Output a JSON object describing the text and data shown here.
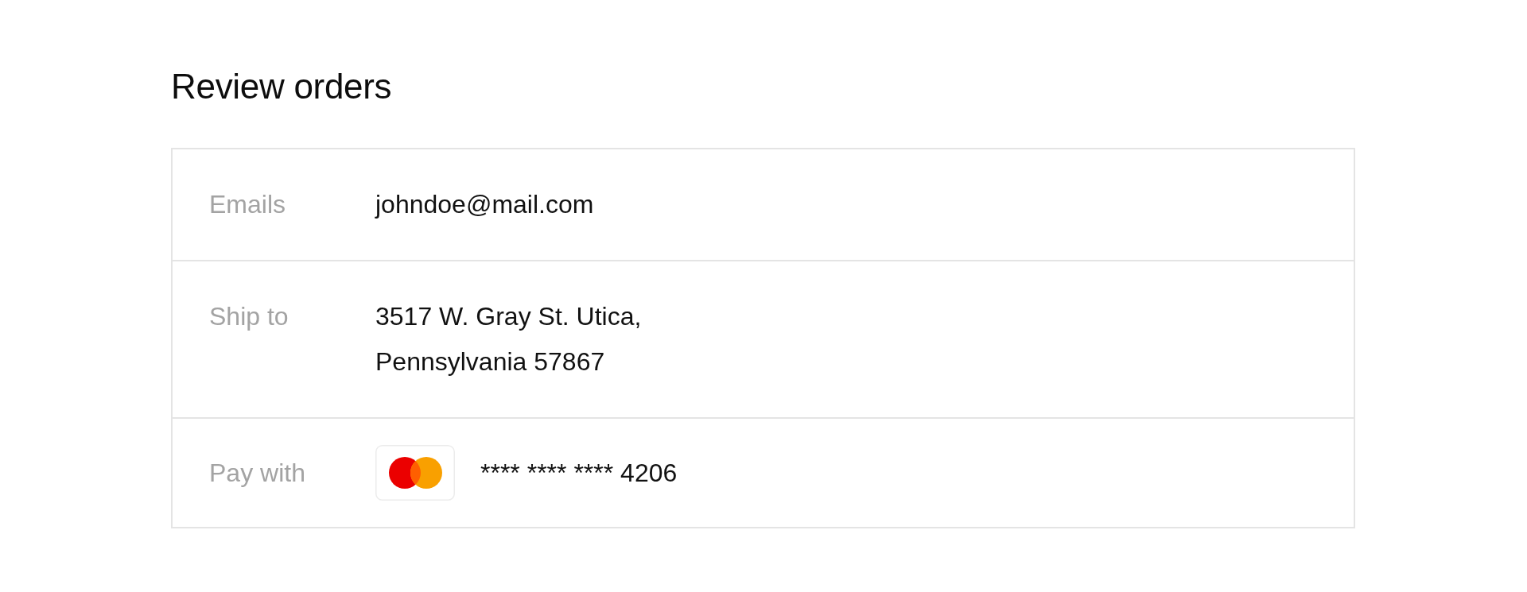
{
  "title": "Review orders",
  "rows": [
    {
      "kind": "text",
      "label": "Emails",
      "value": "johndoe@mail.com"
    },
    {
      "kind": "text",
      "label": "Ship to",
      "value": "3517 W. Gray St. Utica,\nPennsylvania 57867"
    },
    {
      "kind": "card",
      "label": "Pay with",
      "card_number": "**** **** **** 4206"
    }
  ]
}
